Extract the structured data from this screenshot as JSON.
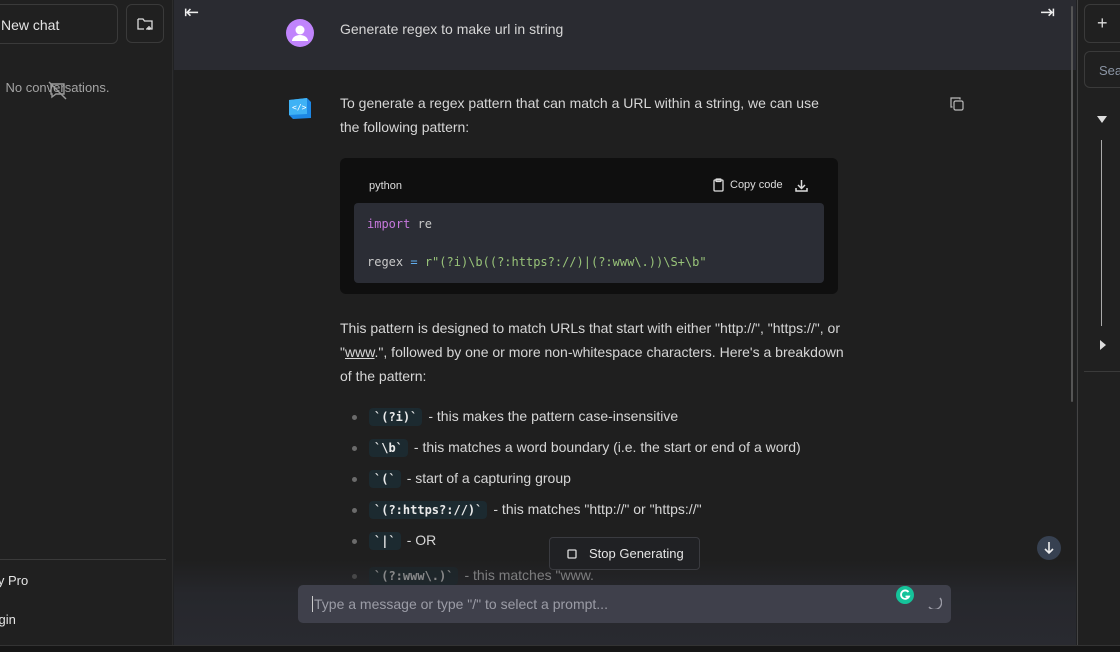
{
  "sidebar": {
    "new_chat_label": "New chat",
    "empty_text": "No conversations.",
    "items": [
      {
        "label": "Buy Pro"
      },
      {
        "label": "Login"
      }
    ]
  },
  "conversation": {
    "user_message": "Generate regex to make url in string",
    "assistant_intro": "To generate a regex pattern that can match a URL within a string, we can use the following pattern:",
    "code_block": {
      "language": "python",
      "copy_label": "Copy code",
      "lines": {
        "l1_kw": "import",
        "l1_rest": " re",
        "l2_var": "regex ",
        "l2_op": "=",
        "l2_str": " r\"(?i)\\b((?:https?://)|(?:www\\.))\\S+\\b\""
      }
    },
    "explanation_before": "This pattern is designed to match URLs that start with either \"http://\", \"https://\", or \"",
    "explanation_link": "www",
    "explanation_after": ".\", followed by one or more non-whitespace characters. Here's a breakdown of the pattern:",
    "bullets": [
      {
        "code": "`(?i)`",
        "text": "- this makes the pattern case-insensitive"
      },
      {
        "code": "`\\b`",
        "text": "- this matches a word boundary (i.e. the start or end of a word)"
      },
      {
        "code": "`(`",
        "text": "- start of a capturing group"
      },
      {
        "code": "`(?:https?://)`",
        "text": "- this matches \"http://\" or \"https://\""
      },
      {
        "code": "`|`",
        "text": "- OR"
      },
      {
        "code": "`(?:www\\.)`",
        "text": "- this matches \"www."
      }
    ]
  },
  "stop_label": "Stop Generating",
  "input": {
    "placeholder": "Type a message or type \"/\" to select a prompt..."
  },
  "right_panel": {
    "search_placeholder": "Search"
  },
  "colors": {
    "user_avatar": "#c084fc",
    "grammarly": "#15c39a",
    "code_keyword": "#c678dd",
    "code_string": "#98c379"
  }
}
